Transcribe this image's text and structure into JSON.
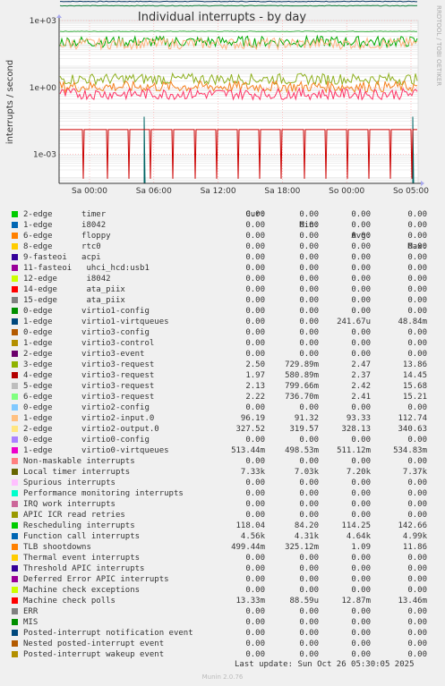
{
  "chart_data": {
    "type": "line",
    "title": "Individual interrupts - by day",
    "ylabel": "interrupts / second",
    "xlabel": "",
    "y_scale": "log",
    "ylim": [
      5e-05,
      1000
    ],
    "y_ticks": [
      {
        "value": 0.001,
        "label": "1e-03"
      },
      {
        "value": 1,
        "label": "1e+00"
      },
      {
        "value": 1000,
        "label": "1e+03"
      }
    ],
    "x_ticks": [
      "Sa 00:00",
      "Sa 06:00",
      "Sa 12:00",
      "Sa 18:00",
      "So 00:00",
      "So 05:00"
    ],
    "grid": true,
    "legend_placement": "bottom",
    "series_avg_levels": [
      {
        "name": "Local timer interrupts",
        "color": "#0a3a66",
        "level": 7200
      },
      {
        "name": "virtio2-output.0",
        "color": "#3cb043",
        "level": 328.13
      },
      {
        "name": "Function call interrupts",
        "color": "#0b7c3a",
        "level": 4640
      },
      {
        "name": "Rescheduling interrupts",
        "color": "#00aa00",
        "level": 114.25
      },
      {
        "name": "virtio2-input.0",
        "color": "#ffb380",
        "level": 93.33
      },
      {
        "name": "virtio3-request",
        "color": "#8fb020",
        "level": 2.4
      },
      {
        "name": "TLB shootdowns",
        "color": "#f58220",
        "level": 1.09
      },
      {
        "name": "virtio1-virtqueues",
        "color": "#006666",
        "level": 0.24167
      },
      {
        "name": "virtio0-virtqueues",
        "color": "#ff3366",
        "level": 0.511
      },
      {
        "name": "Machine check polls",
        "color": "#cc0000",
        "level": 0.01287
      }
    ]
  },
  "legend": {
    "headers": {
      "cur": "Cur:",
      "min": "Min:",
      "avg": "Avg:",
      "max": "Max:"
    },
    "rows": [
      {
        "name": "2-edge      timer",
        "color": "#00cc00",
        "cur": "0.00",
        "min": "0.00",
        "avg": "0.00",
        "max": "0.00"
      },
      {
        "name": "1-edge      i8042",
        "color": "#0066b3",
        "cur": "0.00",
        "min": "0.00",
        "avg": "0.00",
        "max": "0.00"
      },
      {
        "name": "6-edge      floppy",
        "color": "#ff8000",
        "cur": "0.00",
        "min": "0.00",
        "avg": "0.00",
        "max": "0.00"
      },
      {
        "name": "8-edge      rtc0",
        "color": "#ffcc00",
        "cur": "0.00",
        "min": "0.00",
        "avg": "0.00",
        "max": "0.00"
      },
      {
        "name": "9-fasteoi   acpi",
        "color": "#330099",
        "cur": "0.00",
        "min": "0.00",
        "avg": "0.00",
        "max": "0.00"
      },
      {
        "name": "11-fasteoi   uhci_hcd:usb1",
        "color": "#990099",
        "cur": "0.00",
        "min": "0.00",
        "avg": "0.00",
        "max": "0.00"
      },
      {
        "name": "12-edge      i8042",
        "color": "#ccff00",
        "cur": "0.00",
        "min": "0.00",
        "avg": "0.00",
        "max": "0.00"
      },
      {
        "name": "14-edge      ata_piix",
        "color": "#ff0000",
        "cur": "0.00",
        "min": "0.00",
        "avg": "0.00",
        "max": "0.00"
      },
      {
        "name": "15-edge      ata_piix",
        "color": "#808080",
        "cur": "0.00",
        "min": "0.00",
        "avg": "0.00",
        "max": "0.00"
      },
      {
        "name": "0-edge      virtio1-config",
        "color": "#008f00",
        "cur": "0.00",
        "min": "0.00",
        "avg": "0.00",
        "max": "0.00"
      },
      {
        "name": "1-edge      virtio1-virtqueues",
        "color": "#00487d",
        "cur": "0.00",
        "min": "0.00",
        "avg": "241.67u",
        "max": "48.84m"
      },
      {
        "name": "0-edge      virtio3-config",
        "color": "#b35a00",
        "cur": "0.00",
        "min": "0.00",
        "avg": "0.00",
        "max": "0.00"
      },
      {
        "name": "1-edge      virtio3-control",
        "color": "#b38f00",
        "cur": "0.00",
        "min": "0.00",
        "avg": "0.00",
        "max": "0.00"
      },
      {
        "name": "2-edge      virtio3-event",
        "color": "#6b006b",
        "cur": "0.00",
        "min": "0.00",
        "avg": "0.00",
        "max": "0.00"
      },
      {
        "name": "3-edge      virtio3-request",
        "color": "#8fb300",
        "cur": "2.50",
        "min": "729.89m",
        "avg": "2.47",
        "max": "13.86"
      },
      {
        "name": "4-edge      virtio3-request",
        "color": "#b30000",
        "cur": "1.97",
        "min": "580.89m",
        "avg": "2.37",
        "max": "14.45"
      },
      {
        "name": "5-edge      virtio3-request",
        "color": "#bebebe",
        "cur": "2.13",
        "min": "799.66m",
        "avg": "2.42",
        "max": "15.68"
      },
      {
        "name": "6-edge      virtio3-request",
        "color": "#80ff80",
        "cur": "2.22",
        "min": "736.70m",
        "avg": "2.41",
        "max": "15.21"
      },
      {
        "name": "0-edge      virtio2-config",
        "color": "#80c9ff",
        "cur": "0.00",
        "min": "0.00",
        "avg": "0.00",
        "max": "0.00"
      },
      {
        "name": "1-edge      virtio2-input.0",
        "color": "#ffc080",
        "cur": "96.19",
        "min": "91.32",
        "avg": "93.33",
        "max": "112.74"
      },
      {
        "name": "2-edge      virtio2-output.0",
        "color": "#ffe680",
        "cur": "327.52",
        "min": "319.57",
        "avg": "328.13",
        "max": "340.63"
      },
      {
        "name": "0-edge      virtio0-config",
        "color": "#aa80ff",
        "cur": "0.00",
        "min": "0.00",
        "avg": "0.00",
        "max": "0.00"
      },
      {
        "name": "1-edge      virtio0-virtqueues",
        "color": "#ee00cc",
        "cur": "513.44m",
        "min": "498.53m",
        "avg": "511.12m",
        "max": "534.83m"
      },
      {
        "name": "Non-maskable interrupts",
        "color": "#ff8080",
        "cur": "0.00",
        "min": "0.00",
        "avg": "0.00",
        "max": "0.00"
      },
      {
        "name": "Local timer interrupts",
        "color": "#666600",
        "cur": "7.33k",
        "min": "7.03k",
        "avg": "7.20k",
        "max": "7.37k"
      },
      {
        "name": "Spurious interrupts",
        "color": "#ffbfff",
        "cur": "0.00",
        "min": "0.00",
        "avg": "0.00",
        "max": "0.00"
      },
      {
        "name": "Performance monitoring interrupts",
        "color": "#00ffcc",
        "cur": "0.00",
        "min": "0.00",
        "avg": "0.00",
        "max": "0.00"
      },
      {
        "name": "IRQ work interrupts",
        "color": "#cc6699",
        "cur": "0.00",
        "min": "0.00",
        "avg": "0.00",
        "max": "0.00"
      },
      {
        "name": "APIC ICR read retries",
        "color": "#999900",
        "cur": "0.00",
        "min": "0.00",
        "avg": "0.00",
        "max": "0.00"
      },
      {
        "name": "Rescheduling interrupts",
        "color": "#00cc00",
        "cur": "118.04",
        "min": "84.20",
        "avg": "114.25",
        "max": "142.66"
      },
      {
        "name": "Function call interrupts",
        "color": "#0066b3",
        "cur": "4.56k",
        "min": "4.31k",
        "avg": "4.64k",
        "max": "4.99k"
      },
      {
        "name": "TLB shootdowns",
        "color": "#ff8000",
        "cur": "499.44m",
        "min": "325.12m",
        "avg": "1.09",
        "max": "11.86"
      },
      {
        "name": "Thermal event interrupts",
        "color": "#ffcc00",
        "cur": "0.00",
        "min": "0.00",
        "avg": "0.00",
        "max": "0.00"
      },
      {
        "name": "Threshold APIC interrupts",
        "color": "#330099",
        "cur": "0.00",
        "min": "0.00",
        "avg": "0.00",
        "max": "0.00"
      },
      {
        "name": "Deferred Error APIC interrupts",
        "color": "#990099",
        "cur": "0.00",
        "min": "0.00",
        "avg": "0.00",
        "max": "0.00"
      },
      {
        "name": "Machine check exceptions",
        "color": "#ccff00",
        "cur": "0.00",
        "min": "0.00",
        "avg": "0.00",
        "max": "0.00"
      },
      {
        "name": "Machine check polls",
        "color": "#ff0000",
        "cur": "13.33m",
        "min": "88.59u",
        "avg": "12.87m",
        "max": "13.46m"
      },
      {
        "name": "ERR",
        "color": "#808080",
        "cur": "0.00",
        "min": "0.00",
        "avg": "0.00",
        "max": "0.00"
      },
      {
        "name": "MIS",
        "color": "#008f00",
        "cur": "0.00",
        "min": "0.00",
        "avg": "0.00",
        "max": "0.00"
      },
      {
        "name": "Posted-interrupt notification event",
        "color": "#00487d",
        "cur": "0.00",
        "min": "0.00",
        "avg": "0.00",
        "max": "0.00"
      },
      {
        "name": "Nested posted-interrupt event",
        "color": "#b35a00",
        "cur": "0.00",
        "min": "0.00",
        "avg": "0.00",
        "max": "0.00"
      },
      {
        "name": "Posted-interrupt wakeup event",
        "color": "#b38f00",
        "cur": "0.00",
        "min": "0.00",
        "avg": "0.00",
        "max": "0.00"
      }
    ]
  },
  "footer": {
    "last_update": "Last update: Sun Oct 26 05:30:05 2025",
    "munin": "Munin 2.0.76"
  },
  "watermark": "RRDTOOL / TOBI OETIKER",
  "colors": {
    "background": "#f0f0f0",
    "plot_bg": "#ffffff",
    "grid_major": "#ff9999",
    "grid_minor": "#dddddd"
  }
}
